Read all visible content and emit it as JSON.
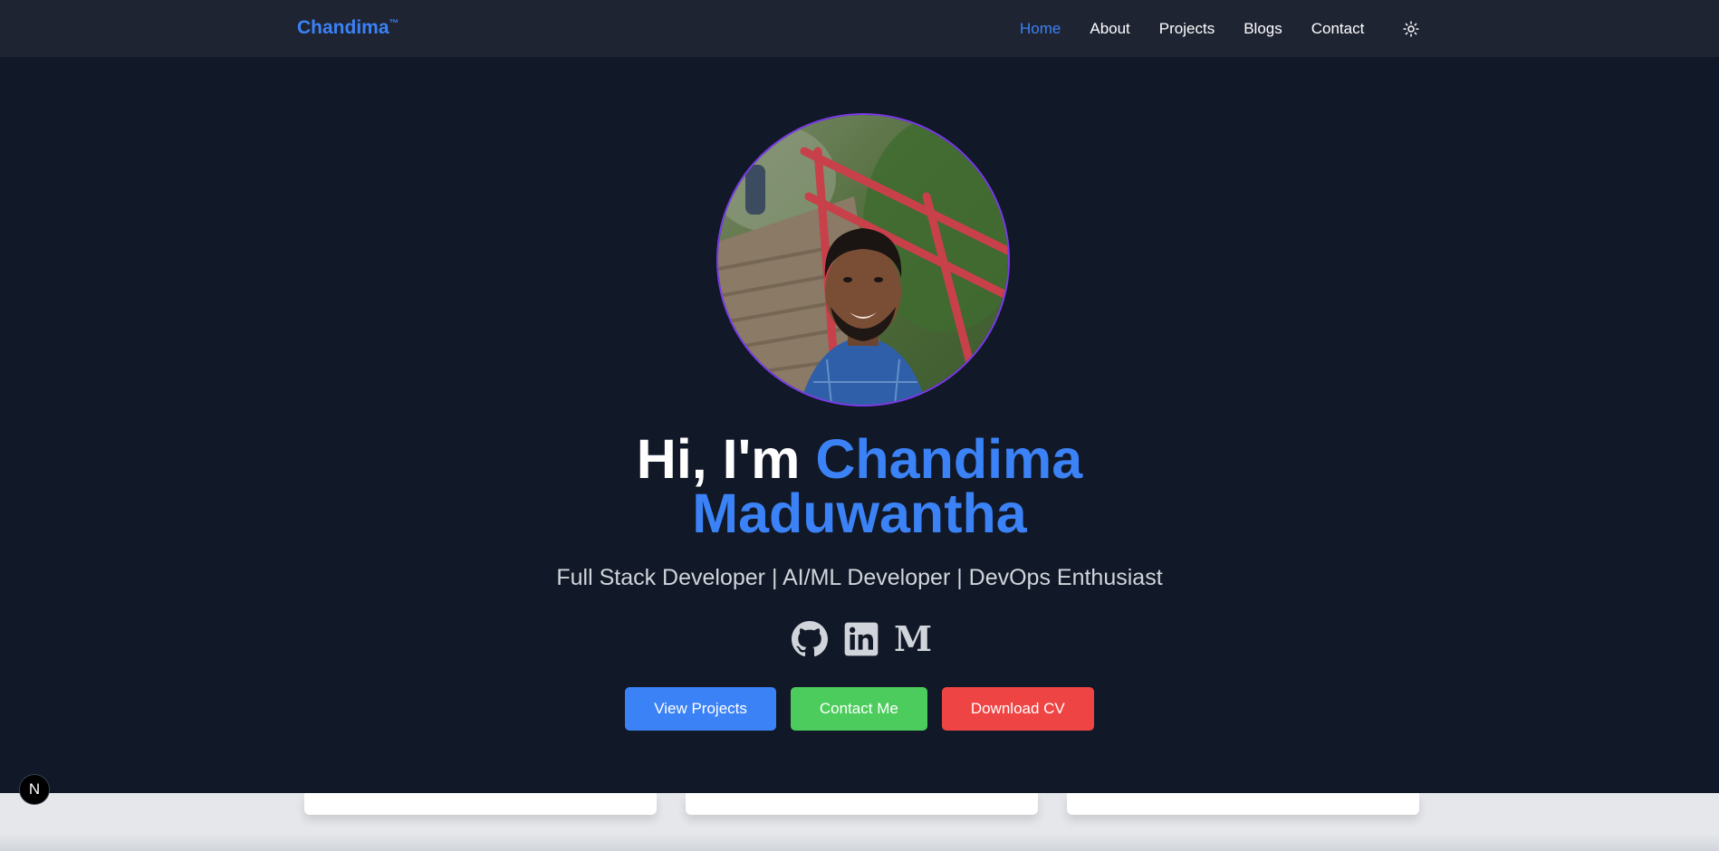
{
  "nav": {
    "brand": "Chandima",
    "brand_mark": "™",
    "links": [
      "Home",
      "About",
      "Projects",
      "Blogs",
      "Contact"
    ],
    "active": "Home",
    "theme_icon": "sun-icon"
  },
  "hero": {
    "greeting": "Hi, I'm ",
    "name_line1": "Chandima",
    "name_line2": "Maduwantha",
    "subtitle": "Full Stack Developer | AI/ML Developer | DevOps Enthusiast",
    "socials": [
      "github-icon",
      "linkedin-icon",
      "medium-icon"
    ],
    "medium_letter": "M",
    "buttons": {
      "view_projects": "View Projects",
      "contact_me": "Contact Me",
      "download_cv": "Download CV"
    }
  },
  "badge": {
    "letter": "N"
  },
  "colors": {
    "accent": "#3b82f6",
    "green": "#4ccc5c",
    "red": "#ef4444",
    "background": "#111827",
    "navbar": "#1f2433",
    "avatar_border": "#7c3aed"
  }
}
